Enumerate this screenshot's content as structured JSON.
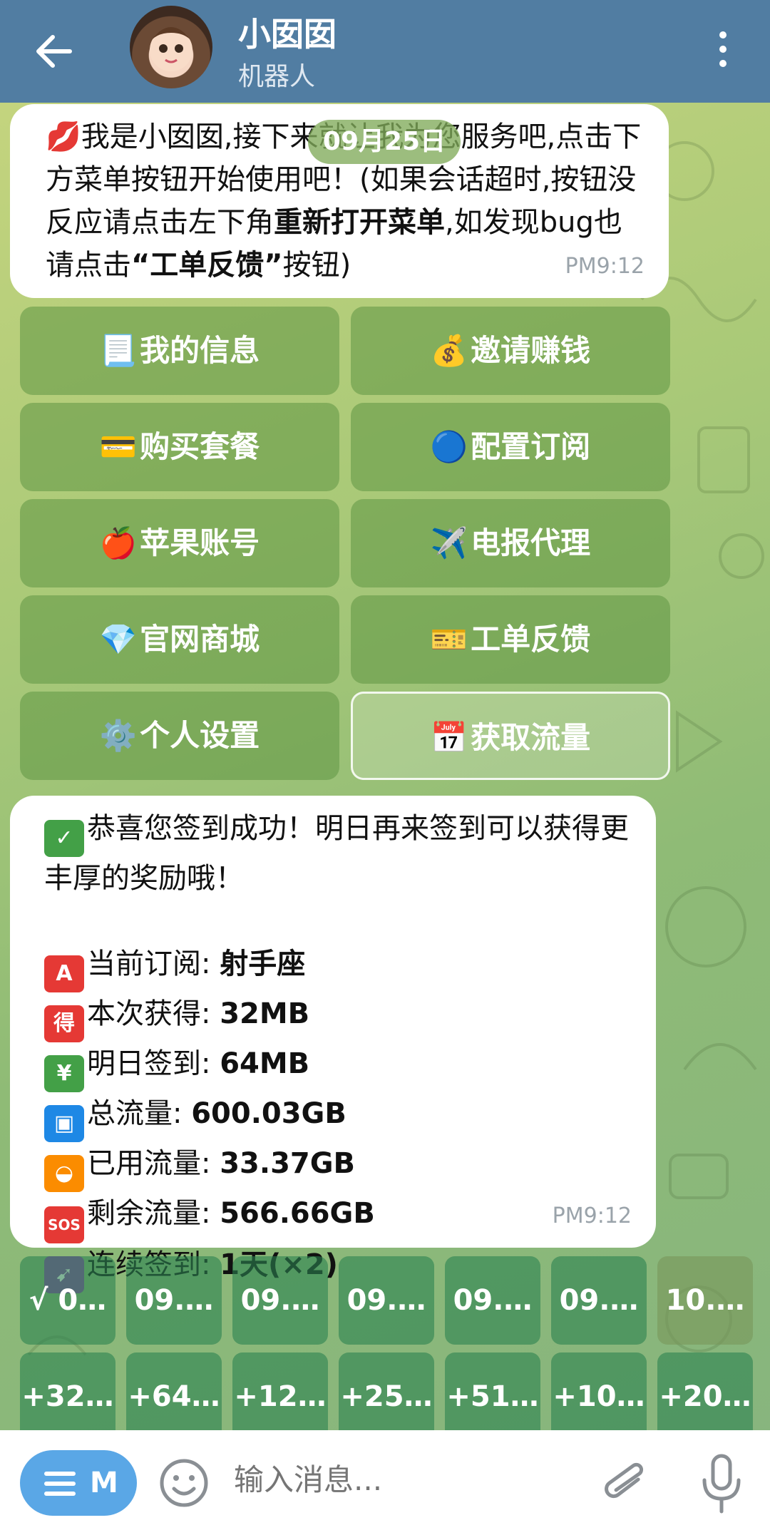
{
  "header": {
    "title": "小囡囡",
    "subtitle": "机器人"
  },
  "date_pill": "09月25日",
  "welcome": {
    "emoji": "💋",
    "part1": "我是小囡囡,接下来就让我为您服务吧,点击下方菜单按钮开始使用吧！(如果会话超时,按钮没反应请点击左下角",
    "bold1": "重新打开菜单",
    "part2": ",如发现bug也请点击",
    "quote_open": "“",
    "bold2": "工单反馈",
    "quote_close": "”",
    "part3": "按钮)",
    "time": "PM9:12"
  },
  "inline_buttons": [
    {
      "emoji": "📃",
      "label": "我的信息"
    },
    {
      "emoji": "💰",
      "label": "邀请赚钱"
    },
    {
      "emoji": "💳",
      "label": "购买套餐"
    },
    {
      "emoji": "🔵",
      "label": "配置订阅"
    },
    {
      "emoji": "🍎",
      "label": "苹果账号"
    },
    {
      "emoji": "✈️",
      "label": "电报代理"
    },
    {
      "emoji": "💎",
      "label": "官网商城"
    },
    {
      "emoji": "🎫",
      "label": "工单反馈"
    },
    {
      "emoji": "⚙️",
      "label": "个人设置"
    },
    {
      "emoji": "📅",
      "label": "获取流量"
    }
  ],
  "checkin": {
    "headline": "恭喜您签到成功！明日再来签到可以获得更丰厚的奖励哦！",
    "rows": [
      {
        "emoji": "A",
        "label": "当前订阅: ",
        "value": "射手座",
        "color": "#e53935"
      },
      {
        "emoji": "得",
        "label": "本次获得: ",
        "value": "32MB",
        "color": "#e53935"
      },
      {
        "emoji": "¥",
        "label": "明日签到: ",
        "value": "64MB",
        "color": "#43a047"
      },
      {
        "emoji": "▣",
        "label": "总流量: ",
        "value": "600.03GB",
        "color": "#1e88e5"
      },
      {
        "emoji": "◒",
        "label": "已用流量: ",
        "value": "33.37GB",
        "color": "#fb8c00"
      },
      {
        "emoji": "SOS",
        "label": "剩余流量: ",
        "value": "566.66GB",
        "color": "#e53935"
      },
      {
        "emoji": "➹",
        "label": "连续签到: ",
        "value": "1天(×2)",
        "color": "#8e44ad"
      }
    ],
    "time": "PM9:12"
  },
  "reply_keyboard": {
    "row1": [
      "√ 0…",
      "09.…",
      "09.…",
      "09.…",
      "09.…",
      "09.…",
      "10.…"
    ],
    "row2": [
      "+32…",
      "+64…",
      "+12…",
      "+25…",
      "+51…",
      "+10…",
      "+20…"
    ]
  },
  "input_bar": {
    "menu_label": "M",
    "placeholder": "输入消息..."
  },
  "colors": {
    "header": "#517da2",
    "menu_button": "#5aa7e6"
  }
}
